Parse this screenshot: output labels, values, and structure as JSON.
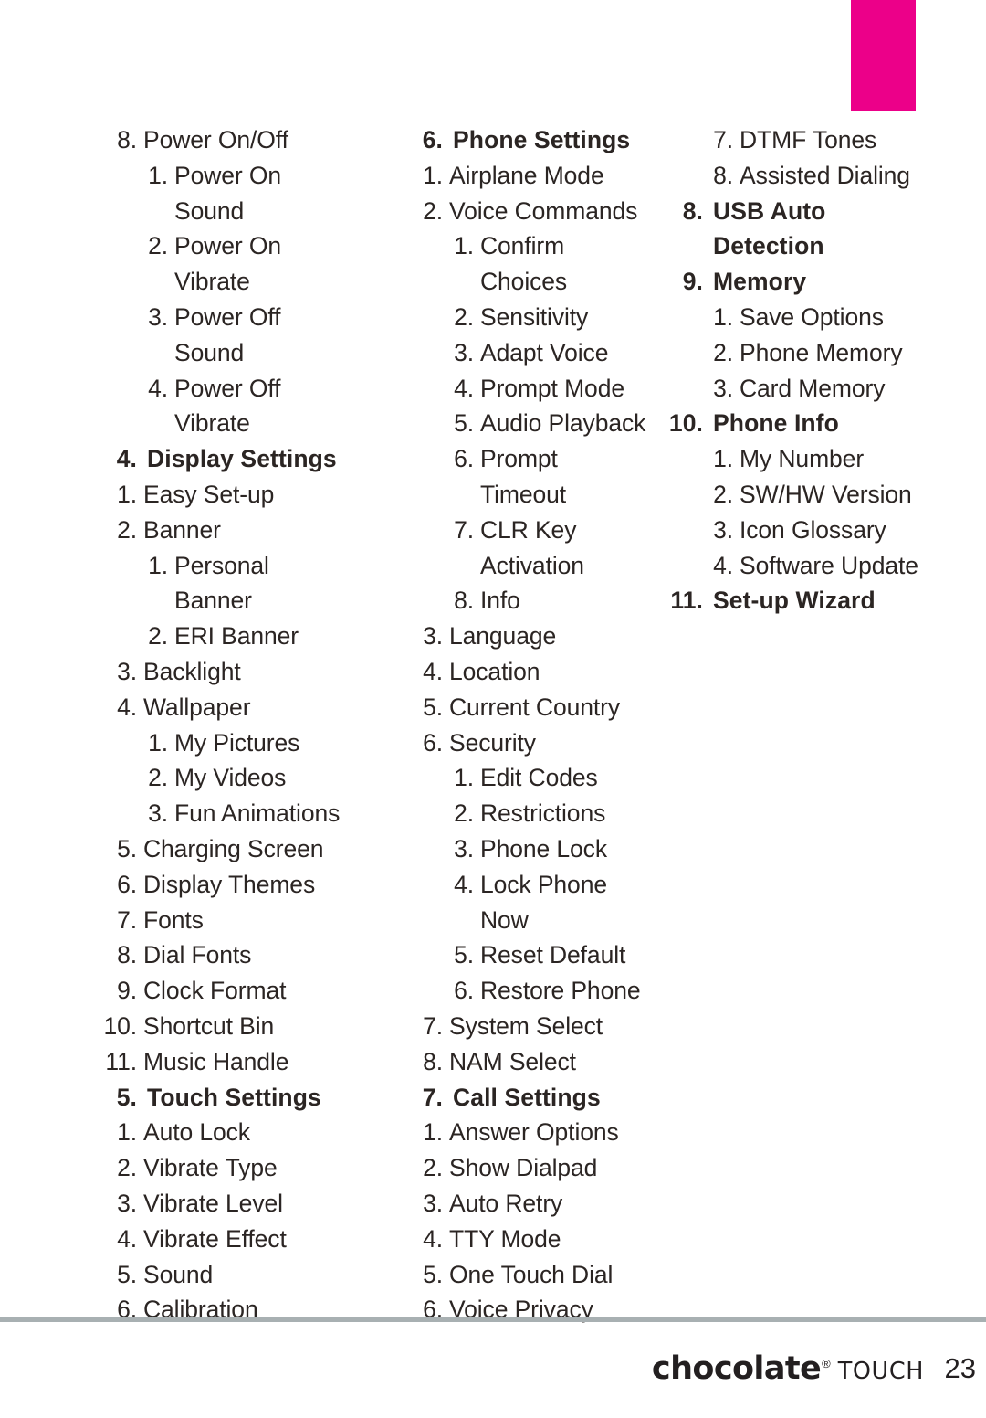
{
  "page": {
    "number": "23",
    "accent_color": "#ec0089",
    "text_color": "#2b2523",
    "rule_color": "#a8b0b2"
  },
  "corner_tab": {
    "name": "section-tab",
    "color": "#ec0089"
  },
  "footer": {
    "brand_main": "chocolate",
    "brand_reg": "®",
    "brand_sub": "TOUCH",
    "page_number": "23"
  },
  "columns": [
    {
      "name": "column-1",
      "entries": [
        {
          "level": 0,
          "num": "8.",
          "label": "Power On/Off",
          "head": false
        },
        {
          "level": 1,
          "num": "1.",
          "label": "Power On",
          "head": false
        },
        {
          "level": 1,
          "num": "",
          "label": "Sound",
          "head": false,
          "cont": true
        },
        {
          "level": 1,
          "num": "2.",
          "label": "Power On",
          "head": false
        },
        {
          "level": 1,
          "num": "",
          "label": "Vibrate",
          "head": false,
          "cont": true
        },
        {
          "level": 1,
          "num": "3.",
          "label": "Power Off",
          "head": false
        },
        {
          "level": 1,
          "num": "",
          "label": "Sound",
          "head": false,
          "cont": true
        },
        {
          "level": 1,
          "num": "4.",
          "label": "Power Off",
          "head": false
        },
        {
          "level": 1,
          "num": "",
          "label": "Vibrate",
          "head": false,
          "cont": true
        },
        {
          "level": 0,
          "num": "4.",
          "label": "Display Settings",
          "head": true
        },
        {
          "level": 0,
          "num": "1.",
          "label": "Easy Set-up",
          "head": false
        },
        {
          "level": 0,
          "num": "2.",
          "label": "Banner",
          "head": false
        },
        {
          "level": 1,
          "num": "1.",
          "label": "Personal",
          "head": false
        },
        {
          "level": 1,
          "num": "",
          "label": "Banner",
          "head": false,
          "cont": true
        },
        {
          "level": 1,
          "num": "2.",
          "label": "ERI Banner",
          "head": false
        },
        {
          "level": 0,
          "num": "3.",
          "label": "Backlight",
          "head": false
        },
        {
          "level": 0,
          "num": "4.",
          "label": "Wallpaper",
          "head": false
        },
        {
          "level": 1,
          "num": "1.",
          "label": "My Pictures",
          "head": false
        },
        {
          "level": 1,
          "num": "2.",
          "label": "My Videos",
          "head": false
        },
        {
          "level": 1,
          "num": "3.",
          "label": "Fun Animations",
          "head": false
        },
        {
          "level": 0,
          "num": "5.",
          "label": "Charging Screen",
          "head": false
        },
        {
          "level": 0,
          "num": "6.",
          "label": "Display Themes",
          "head": false
        },
        {
          "level": 0,
          "num": "7.",
          "label": "Fonts",
          "head": false
        },
        {
          "level": 0,
          "num": "8.",
          "label": "Dial Fonts",
          "head": false
        },
        {
          "level": 0,
          "num": "9.",
          "label": "Clock Format",
          "head": false
        },
        {
          "level": 0,
          "num": "10.",
          "label": "Shortcut Bin",
          "head": false
        },
        {
          "level": 0,
          "num": "11.",
          "label": "Music Handle",
          "head": false
        },
        {
          "level": 0,
          "num": "5.",
          "label": "Touch Settings",
          "head": true
        },
        {
          "level": 0,
          "num": "1.",
          "label": "Auto Lock",
          "head": false
        },
        {
          "level": 0,
          "num": "2.",
          "label": "Vibrate Type",
          "head": false
        },
        {
          "level": 0,
          "num": "3.",
          "label": "Vibrate Level",
          "head": false
        },
        {
          "level": 0,
          "num": "4.",
          "label": "Vibrate Effect",
          "head": false
        },
        {
          "level": 0,
          "num": "5.",
          "label": "Sound",
          "head": false
        },
        {
          "level": 0,
          "num": "6.",
          "label": "Calibration",
          "head": false
        }
      ]
    },
    {
      "name": "column-2",
      "entries": [
        {
          "level": 0,
          "num": "6.",
          "label": "Phone Settings",
          "head": true
        },
        {
          "level": 0,
          "num": "1.",
          "label": "Airplane Mode",
          "head": false
        },
        {
          "level": 0,
          "num": "2.",
          "label": "Voice Commands",
          "head": false
        },
        {
          "level": 1,
          "num": "1.",
          "label": "Confirm",
          "head": false
        },
        {
          "level": 1,
          "num": "",
          "label": "Choices",
          "head": false,
          "cont": true
        },
        {
          "level": 1,
          "num": "2.",
          "label": "Sensitivity",
          "head": false
        },
        {
          "level": 1,
          "num": "3.",
          "label": "Adapt Voice",
          "head": false
        },
        {
          "level": 1,
          "num": "4.",
          "label": "Prompt Mode",
          "head": false
        },
        {
          "level": 1,
          "num": "5.",
          "label": "Audio Playback",
          "head": false
        },
        {
          "level": 1,
          "num": "6.",
          "label": "Prompt",
          "head": false
        },
        {
          "level": 1,
          "num": "",
          "label": "Timeout",
          "head": false,
          "cont": true
        },
        {
          "level": 1,
          "num": "7.",
          "label": "CLR Key",
          "head": false
        },
        {
          "level": 1,
          "num": "",
          "label": "Activation",
          "head": false,
          "cont": true
        },
        {
          "level": 1,
          "num": "8.",
          "label": "Info",
          "head": false
        },
        {
          "level": 0,
          "num": "3.",
          "label": "Language",
          "head": false
        },
        {
          "level": 0,
          "num": "4.",
          "label": "Location",
          "head": false
        },
        {
          "level": 0,
          "num": "5.",
          "label": "Current Country",
          "head": false
        },
        {
          "level": 0,
          "num": "6.",
          "label": "Security",
          "head": false
        },
        {
          "level": 1,
          "num": "1.",
          "label": "Edit Codes",
          "head": false
        },
        {
          "level": 1,
          "num": "2.",
          "label": "Restrictions",
          "head": false
        },
        {
          "level": 1,
          "num": "3.",
          "label": "Phone Lock",
          "head": false
        },
        {
          "level": 1,
          "num": "4.",
          "label": "Lock Phone",
          "head": false
        },
        {
          "level": 1,
          "num": "",
          "label": "Now",
          "head": false,
          "cont": true
        },
        {
          "level": 1,
          "num": "5.",
          "label": "Reset Default",
          "head": false
        },
        {
          "level": 1,
          "num": "6.",
          "label": "Restore Phone",
          "head": false
        },
        {
          "level": 0,
          "num": "7.",
          "label": "System Select",
          "head": false
        },
        {
          "level": 0,
          "num": "8.",
          "label": "NAM Select",
          "head": false
        },
        {
          "level": 0,
          "num": "7.",
          "label": "Call Settings",
          "head": true
        },
        {
          "level": 0,
          "num": "1.",
          "label": "Answer Options",
          "head": false
        },
        {
          "level": 0,
          "num": "2.",
          "label": "Show Dialpad",
          "head": false
        },
        {
          "level": 0,
          "num": "3.",
          "label": "Auto Retry",
          "head": false
        },
        {
          "level": 0,
          "num": "4.",
          "label": "TTY Mode",
          "head": false
        },
        {
          "level": 0,
          "num": "5.",
          "label": "One Touch Dial",
          "head": false
        },
        {
          "level": 0,
          "num": "6.",
          "label": "Voice Privacy",
          "head": false
        }
      ]
    },
    {
      "name": "column-3",
      "entries": [
        {
          "level": 1,
          "num": "7.",
          "label": "DTMF Tones",
          "head": false
        },
        {
          "level": 1,
          "num": "8.",
          "label": "Assisted Dialing",
          "head": false
        },
        {
          "level": 0,
          "num": "8.",
          "label": "USB Auto Detection",
          "head": true
        },
        {
          "level": 0,
          "num": "9.",
          "label": "Memory",
          "head": true
        },
        {
          "level": 1,
          "num": "1.",
          "label": "Save Options",
          "head": false
        },
        {
          "level": 1,
          "num": "2.",
          "label": "Phone Memory",
          "head": false
        },
        {
          "level": 1,
          "num": "3.",
          "label": "Card Memory",
          "head": false
        },
        {
          "level": 0,
          "num": "10.",
          "label": "Phone Info",
          "head": true
        },
        {
          "level": 1,
          "num": "1.",
          "label": "My Number",
          "head": false
        },
        {
          "level": 1,
          "num": "2.",
          "label": "SW/HW Version",
          "head": false
        },
        {
          "level": 1,
          "num": "3.",
          "label": "Icon Glossary",
          "head": false
        },
        {
          "level": 1,
          "num": "4.",
          "label": "Software Update",
          "head": false
        },
        {
          "level": 0,
          "num": "11.",
          "label": "Set-up Wizard",
          "head": true
        }
      ]
    }
  ]
}
